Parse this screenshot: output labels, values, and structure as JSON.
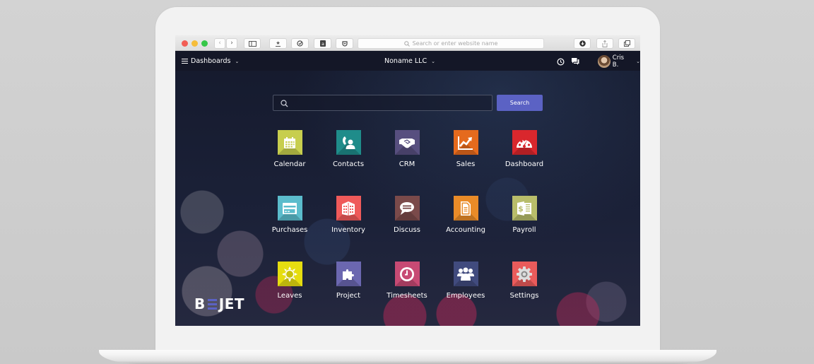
{
  "browser": {
    "url_placeholder": "Search or enter website name",
    "traffic_lights": {
      "close": "#f25d55",
      "minimize": "#f6bd3a",
      "maximize": "#35c748"
    },
    "toolbar_icons": [
      "back-icon",
      "forward-icon",
      "sidebar-icon",
      "bookmark-icon",
      "check-icon",
      "extension-icon",
      "pocket-icon",
      "download-icon",
      "share-icon",
      "tabs-icon"
    ]
  },
  "topnav": {
    "menu_label": "Dashboards",
    "company": "Noname LLC",
    "user_name": "Cris B."
  },
  "search": {
    "placeholder": "",
    "button_label": "Search",
    "button_color": "#5b62c4"
  },
  "apps": [
    {
      "label": "Calendar",
      "color": "#c7ce4e",
      "icon": "calendar-icon"
    },
    {
      "label": "Contacts",
      "color": "#1f8c8a",
      "icon": "contacts-icon"
    },
    {
      "label": "CRM",
      "color": "#574f7f",
      "icon": "handshake-icon"
    },
    {
      "label": "Sales",
      "color": "#e56a1d",
      "icon": "chart-up-icon"
    },
    {
      "label": "Dashboard",
      "color": "#d9272d",
      "icon": "gauge-icon"
    },
    {
      "label": "Purchases",
      "color": "#5bbccc",
      "icon": "credit-card-icon"
    },
    {
      "label": "Inventory",
      "color": "#ef5a5a",
      "icon": "building-icon"
    },
    {
      "label": "Discuss",
      "color": "#7a4a4a",
      "icon": "speech-bubble-icon"
    },
    {
      "label": "Accounting",
      "color": "#e98b28",
      "icon": "document-icon"
    },
    {
      "label": "Payroll",
      "color": "#b8bd6a",
      "icon": "payroll-icon"
    },
    {
      "label": "Leaves",
      "color": "#e6dd10",
      "icon": "sun-icon"
    },
    {
      "label": "Project",
      "color": "#6b67b0",
      "icon": "puzzle-icon"
    },
    {
      "label": "Timesheets",
      "color": "#c74a74",
      "icon": "clock-icon"
    },
    {
      "label": "Employees",
      "color": "#414b7e",
      "icon": "people-icon"
    },
    {
      "label": "Settings",
      "color": "#ea5b5b",
      "icon": "gear-icon"
    }
  ],
  "logo": {
    "left": "B",
    "right": "JET"
  }
}
